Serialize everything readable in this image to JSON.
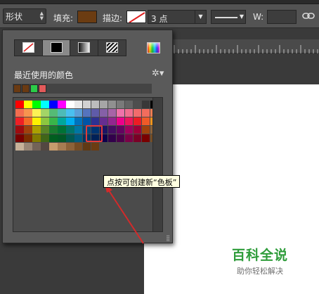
{
  "optionsbar": {
    "mode_label": "形状",
    "fill_label": "填充:",
    "fill_color": "#6b3c12",
    "stroke_label": "描边:",
    "stroke_width": "3 点",
    "w_label": "W:"
  },
  "swatch_panel": {
    "recent_title": "最近使用的颜色",
    "tabs": [
      "no-color-icon",
      "solid-color-icon",
      "gradient-icon",
      "pattern-icon"
    ],
    "recent_colors": [
      "#6a3a12",
      "#6a3a12",
      "#2bcc48",
      "#e35a5a"
    ],
    "grid_rows": [
      [
        "#ff0000",
        "#ffff00",
        "#00ff00",
        "#00ffff",
        "#0000ff",
        "#ff00ff",
        "#ffffff",
        "#e8e8e8",
        "#d2d2d2",
        "#bcbcbc",
        "#a6a6a6",
        "#909090",
        "#7a7a7a",
        "#646464",
        "#4e4e4e",
        "#383838",
        "#000000"
      ],
      [
        "#f36d4f",
        "#f7954f",
        "#fcf255",
        "#a3d566",
        "#55bb75",
        "#4dbbb7",
        "#4ac0f0",
        "#5b9fd8",
        "#5574be",
        "#5f5ba9",
        "#8560a7",
        "#a763a7",
        "#ef72aa",
        "#f16f8f",
        "#f26c6c",
        "#f26d5d",
        "#f47d52"
      ],
      [
        "#ee1f25",
        "#f26b26",
        "#fcf101",
        "#8cc63f",
        "#39b54a",
        "#00a79d",
        "#00aeef",
        "#0072bc",
        "#0054a6",
        "#2e3192",
        "#662d91",
        "#92278f",
        "#ec008c",
        "#ed145b",
        "#ed1c24",
        "#f05a28",
        "#f7941d"
      ],
      [
        "#9e0b0f",
        "#a0410d",
        "#aba000",
        "#598527",
        "#197b30",
        "#007236",
        "#00746b",
        "#0076a3",
        "#004a80",
        "#003471",
        "#1b1464",
        "#440e62",
        "#630460",
        "#9e005d",
        "#9e0039",
        "#a0410d",
        "#8c6239"
      ],
      [
        "#790000",
        "#7b2e00",
        "#827b00",
        "#406618",
        "#005e20",
        "#005826",
        "#005952",
        "#005b7f",
        "#003663",
        "#002157",
        "#0d004c",
        "#32004b",
        "#4b0049",
        "#7b0046",
        "#7a0026",
        "#790000",
        "#754c24"
      ],
      [
        "#c7b299",
        "#998675",
        "#736357",
        "#534741",
        "#c69c6d",
        "#a67c52",
        "#8c6239",
        "#754c24",
        "#603913",
        "#6b3c12",
        "#4b4b4b",
        "#4b4b4b",
        "#4b4b4b",
        "#4b4b4b",
        "#4b4b4b",
        "#4b4b4b",
        "#4b4b4b"
      ]
    ]
  },
  "tooltip": {
    "text": "点按可创建新“色板”"
  },
  "watermark": {
    "title": "百科全说",
    "subtitle": "助你轻松解决"
  },
  "colors": {
    "highlight": "#e23a3a",
    "arrow": "#d42a2a"
  }
}
